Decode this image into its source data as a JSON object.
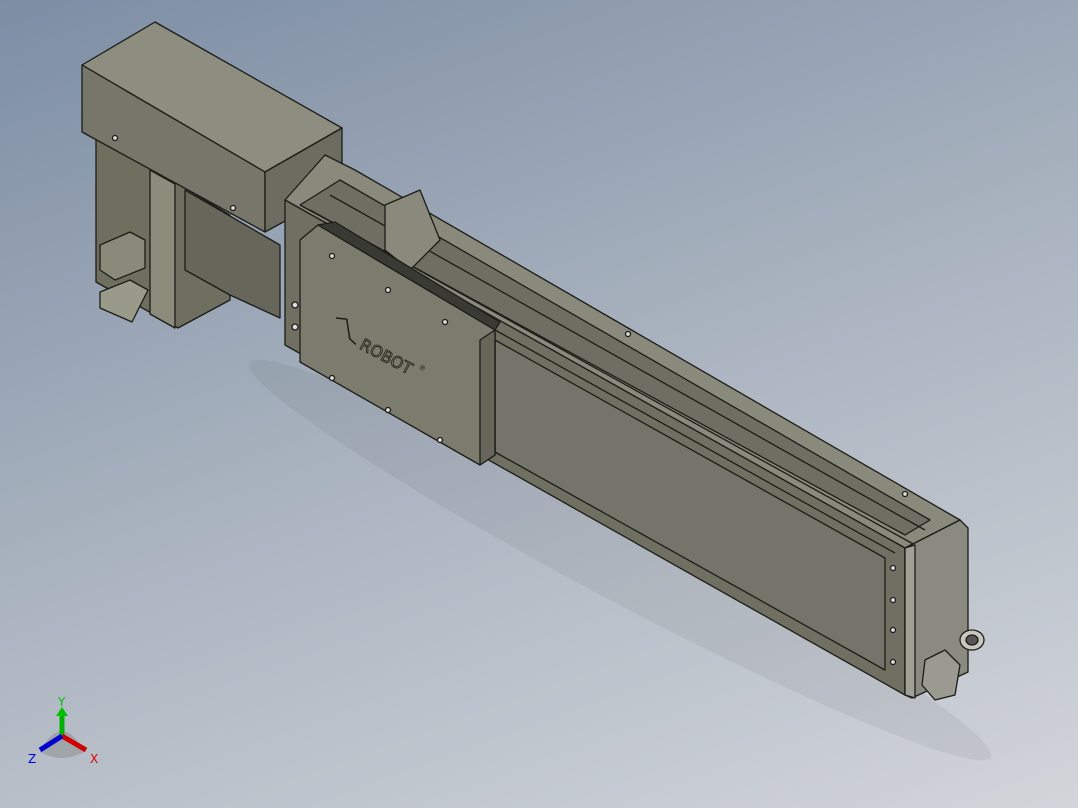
{
  "viewport": {
    "background": "gradient-blue-gray"
  },
  "model": {
    "logo_text": "ROBOT",
    "logo_mark": "®",
    "body_color": "#7a7a68",
    "end_cap_color": "#8a8a80"
  },
  "triad": {
    "x_label": "X",
    "y_label": "Y",
    "z_label": "Z",
    "x_color": "#e00000",
    "y_color": "#00c000",
    "z_color": "#0000e0"
  }
}
